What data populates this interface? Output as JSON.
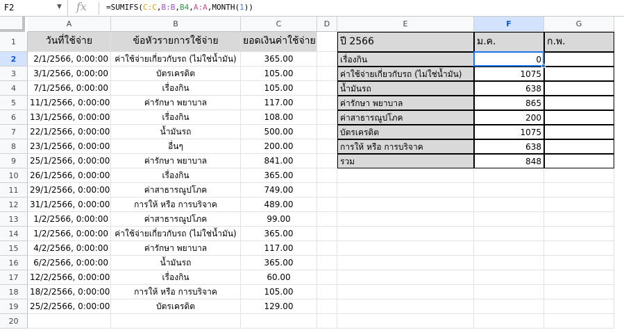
{
  "formula_bar": {
    "cell_ref": "F2",
    "formula_prefix": "=SUMIFS(",
    "arg1": "C:C",
    "arg2": "B:B",
    "arg3": "B4",
    "arg4": "A:A",
    "arg5_fn": "MONTH(",
    "arg5_inner": "1",
    "formula_suffix": "))",
    "fx_label": "fx"
  },
  "columns": [
    "A",
    "B",
    "C",
    "D",
    "E",
    "F",
    "G"
  ],
  "selected_column": "F",
  "selected_row": "2",
  "rows": [
    "1",
    "2",
    "3",
    "4",
    "5",
    "6",
    "7",
    "8",
    "9",
    "10",
    "11",
    "12",
    "13",
    "14",
    "15",
    "16",
    "17",
    "18",
    "19",
    "20"
  ],
  "headers": {
    "A": "วันที่ใช้จ่าย",
    "B": "ข้อหัวรายการใช้จ่าย",
    "C": "ยอดเงินค่าใช้จ่าย",
    "E": "ปี 2566",
    "F": "ม.ค.",
    "G": "ก.พ."
  },
  "expenses": [
    {
      "date": "2/1/2566, 0:00:00",
      "item": "ค่าใช้จ่ายเกี่ยวกับรถ (ไม่ใช่น้ำมัน)",
      "amount": "365.00"
    },
    {
      "date": "3/1/2566, 0:00:00",
      "item": "บัตรเครดิต",
      "amount": "105.00"
    },
    {
      "date": "7/1/2566, 0:00:00",
      "item": "เรื่องกิน",
      "amount": "105.00"
    },
    {
      "date": "11/1/2566, 0:00:00",
      "item": "ค่ารักษา พยาบาล",
      "amount": "117.00"
    },
    {
      "date": "13/1/2566, 0:00:00",
      "item": "เรื่องกิน",
      "amount": "108.00"
    },
    {
      "date": "22/1/2566, 0:00:00",
      "item": "น้ำมันรถ",
      "amount": "500.00"
    },
    {
      "date": "23/1/2566, 0:00:00",
      "item": "อื่นๆ",
      "amount": "200.00"
    },
    {
      "date": "25/1/2566, 0:00:00",
      "item": "ค่ารักษา พยาบาล",
      "amount": "841.00"
    },
    {
      "date": "26/1/2566, 0:00:00",
      "item": "เรื่องกิน",
      "amount": "365.00"
    },
    {
      "date": "29/1/2566, 0:00:00",
      "item": "ค่าสาธารณูปโภค",
      "amount": "749.00"
    },
    {
      "date": "31/1/2566, 0:00:00",
      "item": "การให้ หรือ การบริจาค",
      "amount": "489.00"
    },
    {
      "date": "1/2/2566, 0:00:00",
      "item": "ค่าสาธารณูปโภค",
      "amount": "99.00"
    },
    {
      "date": "1/2/2566, 0:00:00",
      "item": "ค่าใช้จ่ายเกี่ยวกับรถ (ไม่ใช่น้ำมัน)",
      "amount": "365.00"
    },
    {
      "date": "4/2/2566, 0:00:00",
      "item": "ค่ารักษา พยาบาล",
      "amount": "117.00"
    },
    {
      "date": "6/2/2566, 0:00:00",
      "item": "น้ำมันรถ",
      "amount": "365.00"
    },
    {
      "date": "12/2/2566, 0:00:00",
      "item": "เรื่องกิน",
      "amount": "60.00"
    },
    {
      "date": "18/2/2566, 0:00:00",
      "item": "การให้ หรือ การบริจาค",
      "amount": "105.00"
    },
    {
      "date": "25/2/2566, 0:00:00",
      "item": "บัตรเครดิต",
      "amount": "129.00"
    }
  ],
  "summary": [
    {
      "category": "เรื่องกิน",
      "jan": "0",
      "feb": ""
    },
    {
      "category": "ค่าใช้จ่ายเกี่ยวกับรถ (ไม่ใช่น้ำมัน)",
      "jan": "1075",
      "feb": ""
    },
    {
      "category": "น้ำมันรถ",
      "jan": "638",
      "feb": ""
    },
    {
      "category": "ค่ารักษา พยาบาล",
      "jan": "865",
      "feb": ""
    },
    {
      "category": "ค่าสาธารณูปโภค",
      "jan": "200",
      "feb": ""
    },
    {
      "category": "บัตรเครดิต",
      "jan": "1075",
      "feb": ""
    },
    {
      "category": "การให้ หรือ การบริจาค",
      "jan": "638",
      "feb": ""
    },
    {
      "category": "รวม",
      "jan": "848",
      "feb": ""
    }
  ]
}
